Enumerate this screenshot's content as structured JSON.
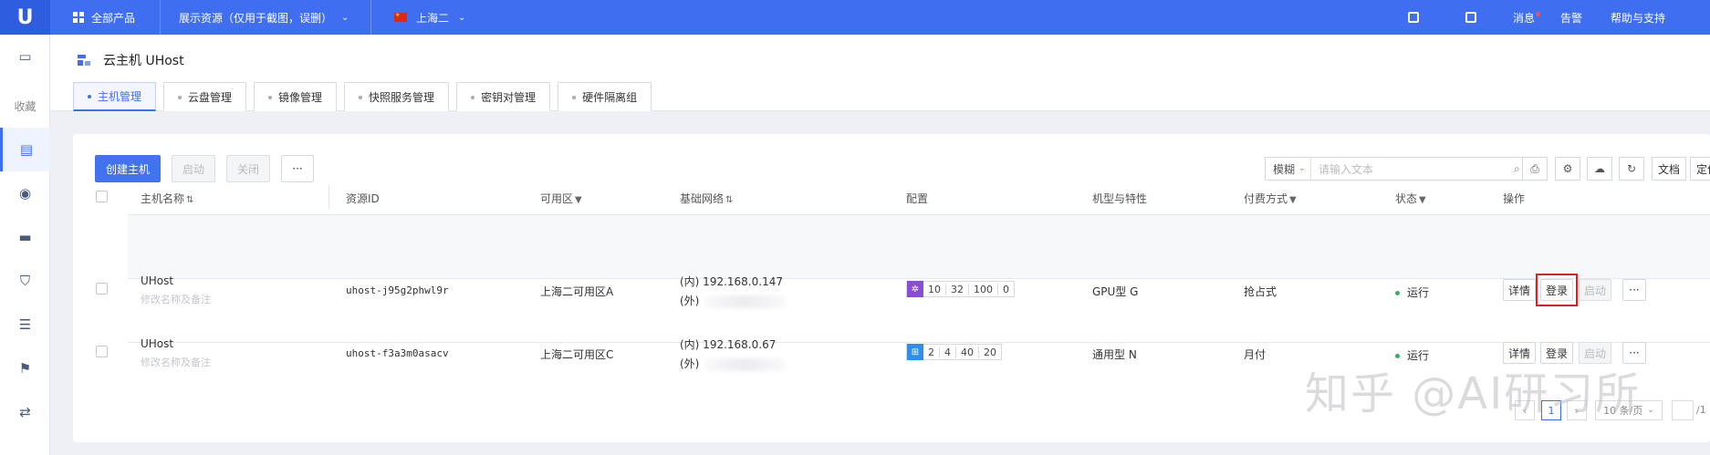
{
  "topbar": {
    "logo": "U",
    "all_products": "全部产品",
    "project": "展示资源（仅用于截图，误删）",
    "region": "上海二",
    "messages": "消息",
    "alerts": "告警",
    "help": "帮助与支持"
  },
  "sidebar": {
    "favorites_label": "收藏",
    "items": [
      "monitor-icon",
      "host-icon",
      "network-icon",
      "chat-icon",
      "shield-icon",
      "list-icon",
      "flag-icon",
      "transfer-icon"
    ]
  },
  "page": {
    "title": "云主机 UHost",
    "tabs": [
      {
        "label": "主机管理",
        "active": true
      },
      {
        "label": "云盘管理"
      },
      {
        "label": "镜像管理"
      },
      {
        "label": "快照服务管理"
      },
      {
        "label": "密钥对管理"
      },
      {
        "label": "硬件隔离组"
      }
    ]
  },
  "toolbar": {
    "create": "创建主机",
    "start": "启动",
    "stop": "关闭",
    "more": "···",
    "search_mode": "模糊",
    "search_placeholder": "请输入文本",
    "docs": "文档",
    "pricing": "定价"
  },
  "table": {
    "headers": [
      "主机名称",
      "资源ID",
      "可用区",
      "基础网络",
      "配置",
      "机型与特性",
      "付费方式",
      "状态",
      "操作"
    ],
    "rows": [
      {
        "name": "UHost",
        "remark": "修改名称及备注",
        "id": "uhost-j95g2phwl9r",
        "zone": "上海二可用区A",
        "ip_inner": "(内) 192.168.0.147",
        "ip_outer": "(外)",
        "config_os": "centos",
        "config": [
          "10",
          "32",
          "100",
          "0"
        ],
        "type": "GPU型 G",
        "billing": "抢占式",
        "status": "运行",
        "actions": {
          "detail": "详情",
          "login": "登录",
          "start": "启动",
          "more": "···"
        }
      },
      {
        "name": "UHost",
        "remark": "修改名称及备注",
        "id": "uhost-f3a3m0asacv",
        "zone": "上海二可用区C",
        "ip_inner": "(内) 192.168.0.67",
        "ip_outer": "(外)",
        "config_os": "windows",
        "config": [
          "2",
          "4",
          "40",
          "20"
        ],
        "type": "通用型 N",
        "billing": "月付",
        "status": "运行",
        "actions": {
          "detail": "详情",
          "login": "登录",
          "start": "启动",
          "more": "···"
        }
      }
    ]
  },
  "pagination": {
    "prev": "‹",
    "page": "1",
    "next": "›",
    "per_page": "10 条/页",
    "total_suffix": "/1"
  },
  "watermark": "知乎 @AI研习所",
  "colors": {
    "topbar": "#3f6ff0",
    "primary": "#4273ef",
    "status_running": "#2db55d",
    "highlight": "#e02020"
  }
}
